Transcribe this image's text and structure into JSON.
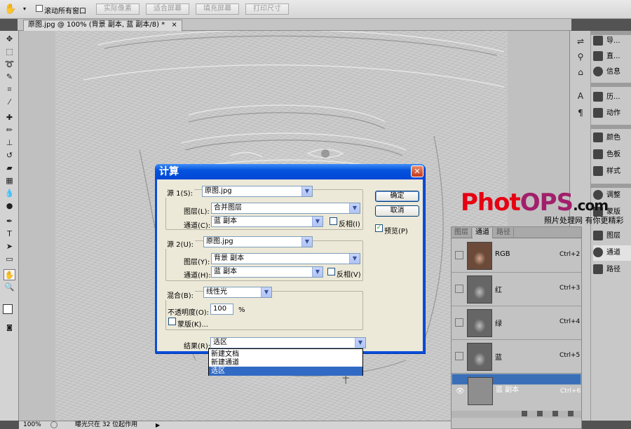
{
  "options_bar": {
    "hand_icon": "hand-icon",
    "scroll_all_label": "滚动所有窗口",
    "buttons": [
      "实际像素",
      "适合屏幕",
      "填充屏幕",
      "打印尺寸"
    ]
  },
  "document_tab": {
    "title": "原图.jpg @ 100% (背景 副本, 蓝 副本/8) *",
    "close": "×"
  },
  "status_bar": {
    "zoom": "100%",
    "message": "曝光只在 32 位起作用"
  },
  "dock_icons": [
    "nav-icon",
    "histogram-icon",
    "info-icon",
    "char-icon",
    "para-icon"
  ],
  "dock_panels": [
    {
      "label": "导...",
      "icon": "navigator-icon"
    },
    {
      "label": "直...",
      "icon": "histogram-icon"
    },
    {
      "label": "信息",
      "icon": "info-icon"
    },
    {
      "label": "历...",
      "icon": "history-icon"
    },
    {
      "label": "动作",
      "icon": "actions-icon"
    },
    {
      "label": "颜色",
      "icon": "color-icon"
    },
    {
      "label": "色板",
      "icon": "swatches-icon"
    },
    {
      "label": "样式",
      "icon": "styles-icon"
    },
    {
      "label": "调整",
      "icon": "adjust-icon"
    },
    {
      "label": "蒙版",
      "icon": "masks-icon"
    },
    {
      "label": "图层",
      "icon": "layers-icon"
    },
    {
      "label": "通道",
      "icon": "channels-icon"
    },
    {
      "label": "路径",
      "icon": "paths-icon"
    }
  ],
  "channels_panel": {
    "tabs": [
      "图层",
      "通道",
      "路径"
    ],
    "active_tab": "通道",
    "rows": [
      {
        "name": "RGB",
        "shortcut": "Ctrl+2",
        "selected": false
      },
      {
        "name": "红",
        "shortcut": "Ctrl+3",
        "selected": false
      },
      {
        "name": "绿",
        "shortcut": "Ctrl+4",
        "selected": false
      },
      {
        "name": "蓝",
        "shortcut": "Ctrl+5",
        "selected": false
      },
      {
        "name": "蓝 副本",
        "shortcut": "Ctrl+6",
        "selected": true
      }
    ]
  },
  "watermark": {
    "part1": "Phot",
    "part2": "OPS",
    "part3": ".com",
    "subtitle": "照片处理网 有你更精彩"
  },
  "dialog": {
    "title": "计算",
    "close": "✕",
    "source1": {
      "label": "源 1(S):",
      "file": "原图.jpg",
      "layer_label": "图层(L):",
      "layer": "合并图层",
      "channel_label": "通道(C):",
      "channel": "蓝 副本",
      "invert_label": "反相(I)",
      "invert": false
    },
    "source2": {
      "label": "源 2(U):",
      "file": "原图.jpg",
      "layer_label": "图层(Y):",
      "layer": "背景 副本",
      "channel_label": "通道(H):",
      "channel": "蓝 副本",
      "invert_label": "反相(V)",
      "invert": false
    },
    "blending": {
      "label": "混合(B):",
      "mode": "线性光",
      "opacity_label": "不透明度(O):",
      "opacity": "100",
      "percent": "%",
      "mask_label": "蒙版(K)...",
      "mask": false
    },
    "result": {
      "label": "结果(R):",
      "value": "选区",
      "options": [
        "新建文档",
        "新建通道",
        "选区"
      ],
      "highlighted": "选区"
    },
    "ok": "确定",
    "cancel": "取消",
    "preview_label": "预览(P)",
    "preview": true
  }
}
